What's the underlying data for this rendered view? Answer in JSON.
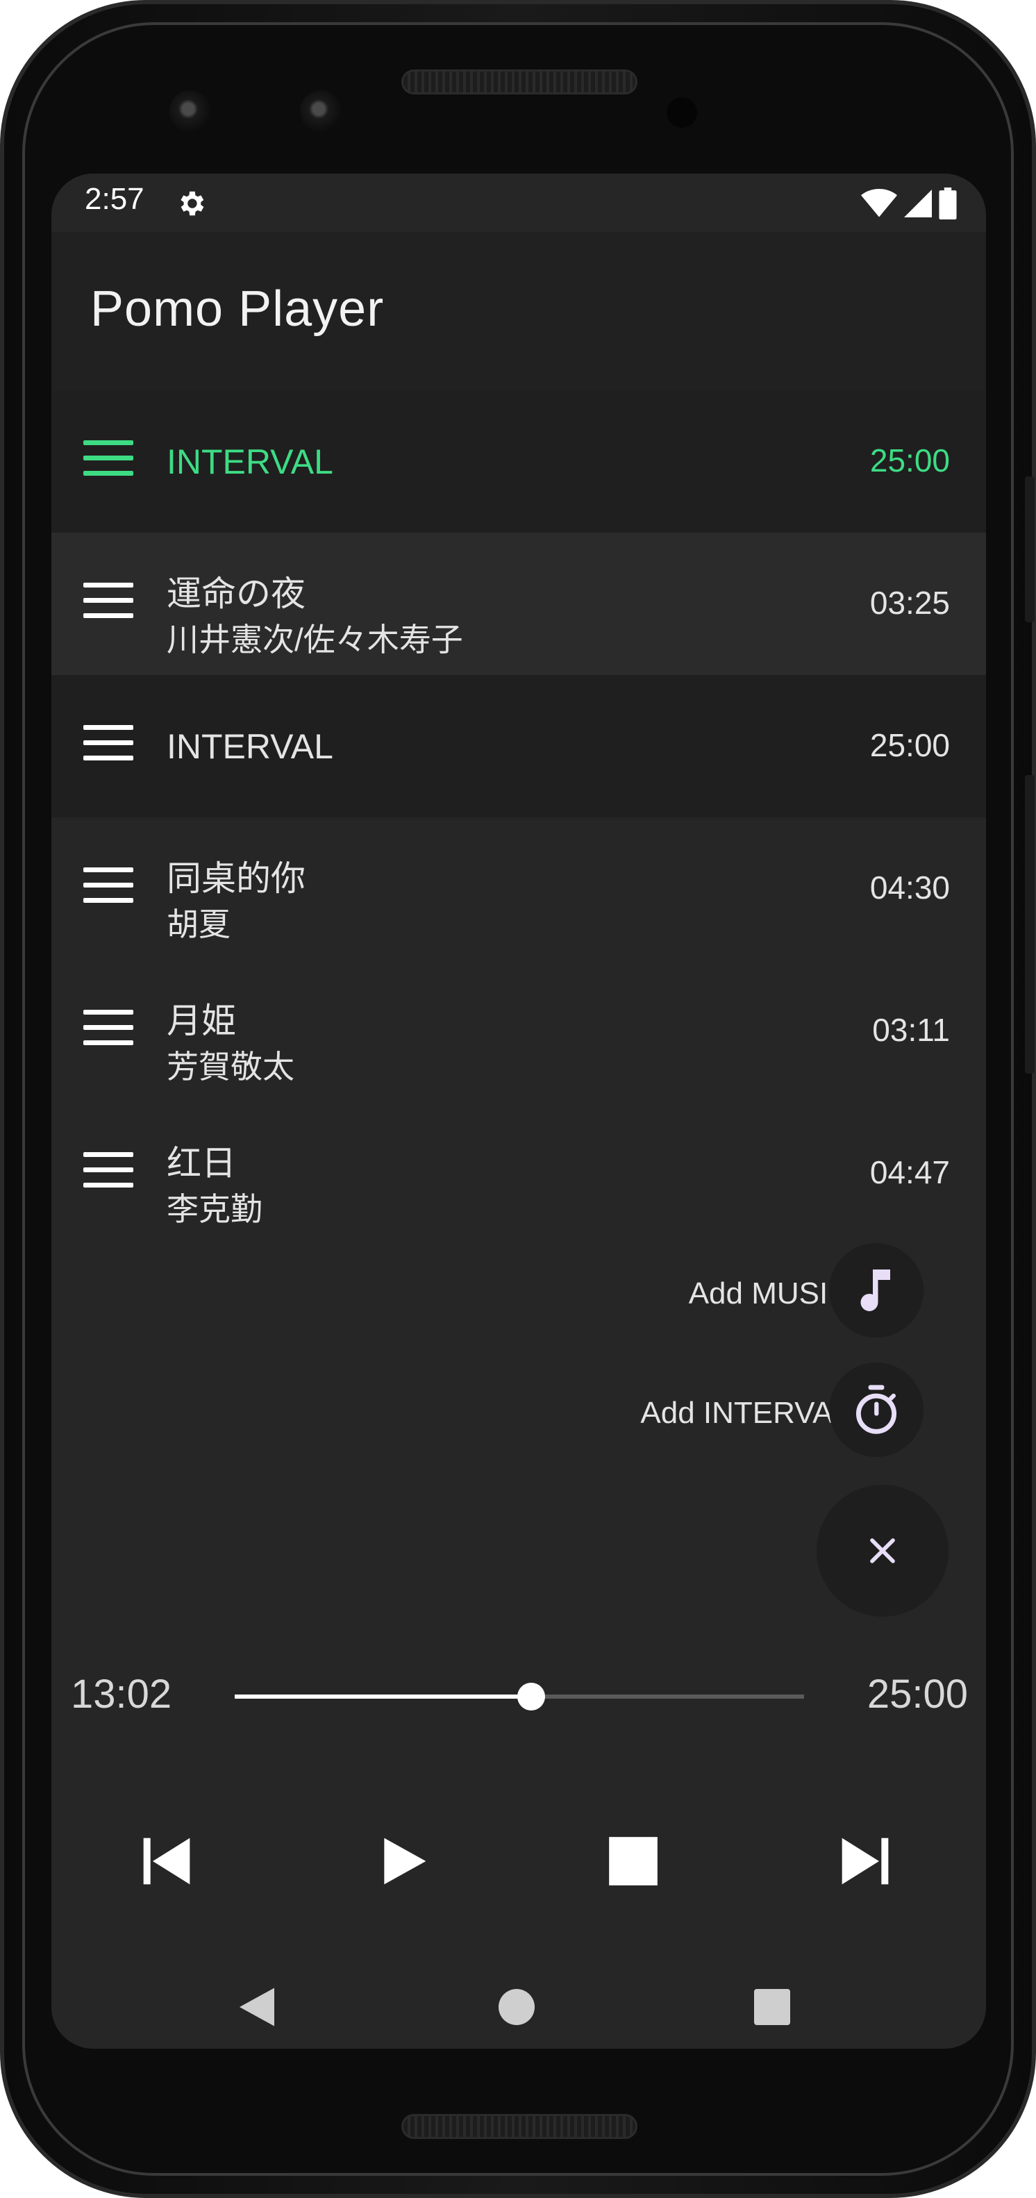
{
  "status_bar": {
    "time": "2:57",
    "icons": [
      "gear-icon",
      "wifi-icon",
      "cellular-signal-icon",
      "battery-icon"
    ]
  },
  "app_bar": {
    "title": "Pomo Player"
  },
  "colors": {
    "accent": "#3ddc84",
    "background": "#262626",
    "text": "#e4e4e4",
    "fab_icon": "#e8def8"
  },
  "queue": [
    {
      "type": "interval",
      "title": "INTERVAL",
      "duration": "25:00",
      "active": true
    },
    {
      "type": "music",
      "title": "運命の夜",
      "artist": "川井憲次/佐々木寿子",
      "duration": "03:25"
    },
    {
      "type": "interval",
      "title": "INTERVAL",
      "duration": "25:00"
    },
    {
      "type": "music",
      "title": "同桌的你",
      "artist": "胡夏",
      "duration": "04:30"
    },
    {
      "type": "music",
      "title": "月姫",
      "artist": "芳賀敬太",
      "duration": "03:11"
    },
    {
      "type": "music",
      "title": "红日",
      "artist": "李克勤",
      "duration": "04:47"
    }
  ],
  "fab_menu": {
    "add_music_label": "Add MUSIC",
    "add_interval_label": "Add INTERVAL"
  },
  "player": {
    "elapsed": "13:02",
    "total": "25:00",
    "progress_fraction": 0.521
  }
}
